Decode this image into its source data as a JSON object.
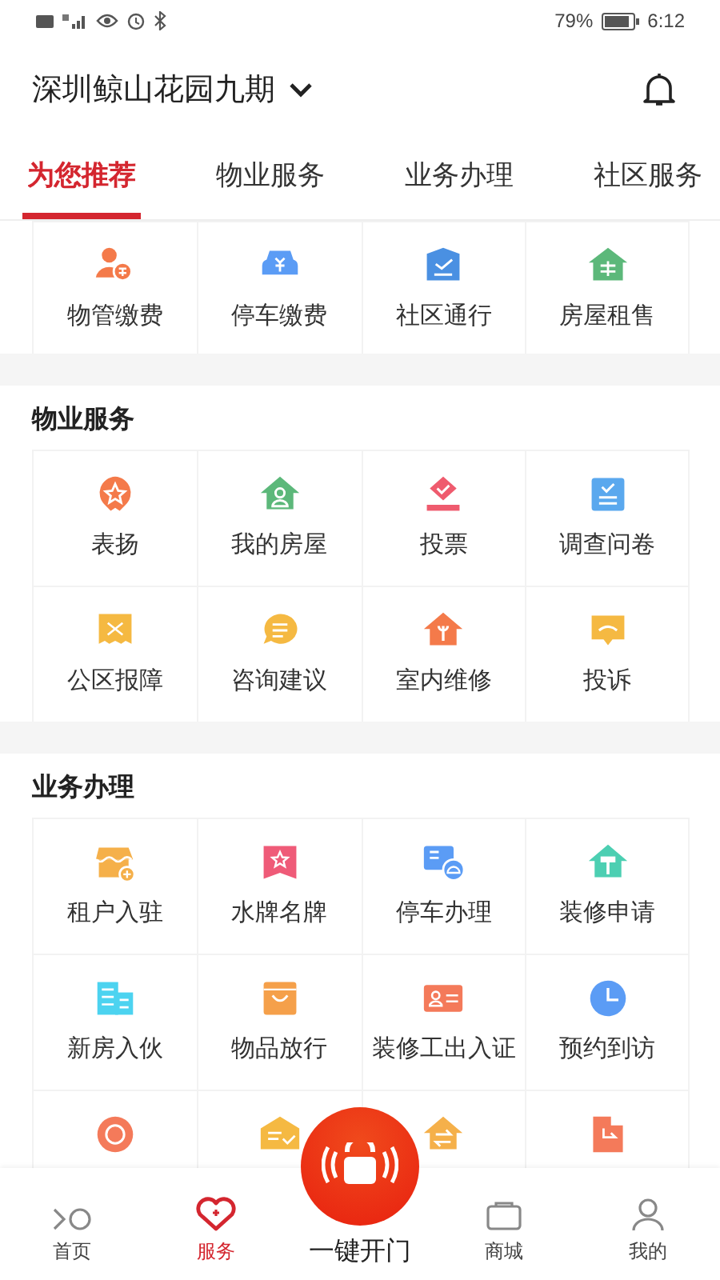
{
  "status_bar": {
    "battery": "79%",
    "time": "6:12"
  },
  "header": {
    "title": "深圳鲸山花园九期"
  },
  "tabs": [
    {
      "label": "为您推荐",
      "selected": true
    },
    {
      "label": "物业服务",
      "selected": false
    },
    {
      "label": "业务办理",
      "selected": false
    },
    {
      "label": "社区服务",
      "selected": false
    }
  ],
  "sections": [
    {
      "items": [
        {
          "kind": "tile",
          "label": "物管缴费"
        },
        {
          "kind": "tile",
          "label": "停车缴费"
        },
        {
          "kind": "tile",
          "label": "社区通行"
        },
        {
          "kind": "tile",
          "label": "房屋租售"
        }
      ]
    },
    {
      "title": "物业服务",
      "items": [
        {
          "kind": "tile",
          "label": "表扬"
        },
        {
          "kind": "tile",
          "label": "我的房屋"
        },
        {
          "kind": "tile",
          "label": "投票"
        },
        {
          "kind": "tile",
          "label": "调查问卷"
        },
        {
          "kind": "tile",
          "label": "公区报障"
        },
        {
          "kind": "tile",
          "label": "咨询建议"
        },
        {
          "kind": "tile",
          "label": "室内维修"
        },
        {
          "kind": "tile",
          "label": "投诉"
        }
      ]
    },
    {
      "title": "业务办理",
      "items": [
        {
          "kind": "tile",
          "label": "租户入驻"
        },
        {
          "kind": "tile",
          "label": "水牌名牌"
        },
        {
          "kind": "tile",
          "label": "停车办理"
        },
        {
          "kind": "tile",
          "label": "装修申请"
        },
        {
          "kind": "tile",
          "label": "新房入伙"
        },
        {
          "kind": "tile",
          "label": "物品放行"
        },
        {
          "kind": "tile",
          "label": "装修工出入证"
        },
        {
          "kind": "tile",
          "label": "预约到访"
        },
        {
          "kind": "partial"
        },
        {
          "kind": "partial"
        },
        {
          "kind": "partial"
        },
        {
          "kind": "partial"
        }
      ]
    }
  ],
  "bottom_nav": [
    {
      "kind": "tab",
      "label": "首页",
      "selected": false
    },
    {
      "kind": "tab",
      "label": "服务",
      "selected": true
    },
    {
      "kind": "action",
      "label": "一键开门",
      "selected": false
    },
    {
      "kind": "tab",
      "label": "商城",
      "selected": false
    },
    {
      "kind": "tab",
      "label": "我的",
      "selected": false
    }
  ]
}
